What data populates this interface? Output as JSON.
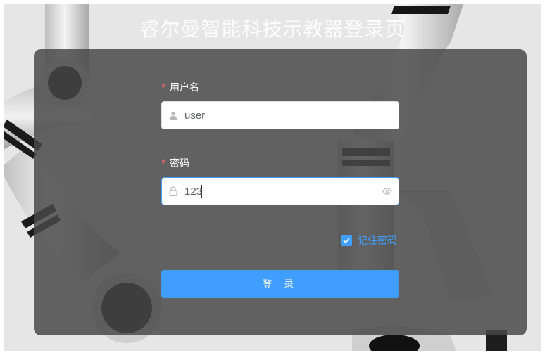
{
  "page": {
    "title": "睿尔曼智能科技示教器登录页"
  },
  "form": {
    "username": {
      "required_mark": "*",
      "label": "用户名",
      "value": "user",
      "icon": "user-icon"
    },
    "password": {
      "required_mark": "*",
      "label": "密码",
      "value": "123",
      "icon": "lock-icon",
      "suffix_icon": "eye-icon"
    },
    "remember": {
      "label": "记住密码",
      "checked": true
    },
    "submit_label": "登 录"
  },
  "colors": {
    "primary": "#409eff",
    "required": "#f56c6c",
    "panel": "#484848"
  }
}
